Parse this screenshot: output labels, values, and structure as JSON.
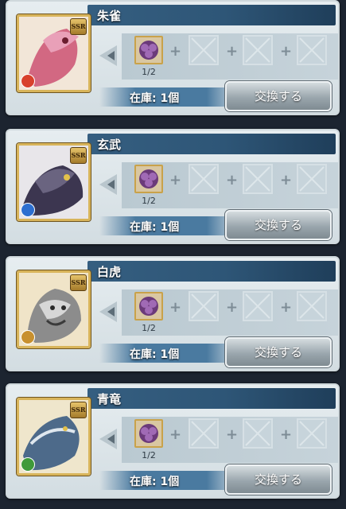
{
  "cards": [
    {
      "name": "朱雀",
      "rarity": "SSR",
      "count": "1/2",
      "stock": "在庫: 1個",
      "button": "交換する",
      "element_color": "#d8412c",
      "art_color": "#c9486d"
    },
    {
      "name": "玄武",
      "rarity": "SSR",
      "count": "1/2",
      "stock": "在庫: 1個",
      "button": "交換する",
      "element_color": "#2d6fd0",
      "art_color": "#3c3650"
    },
    {
      "name": "白虎",
      "rarity": "SSR",
      "count": "1/2",
      "stock": "在庫: 1個",
      "button": "交換する",
      "element_color": "#c8902e",
      "art_color": "#8c8c8c"
    },
    {
      "name": "青竜",
      "rarity": "SSR",
      "count": "1/2",
      "stock": "在庫: 1個",
      "button": "交換する",
      "element_color": "#3f9a3a",
      "art_color": "#4d6a8a"
    }
  ]
}
